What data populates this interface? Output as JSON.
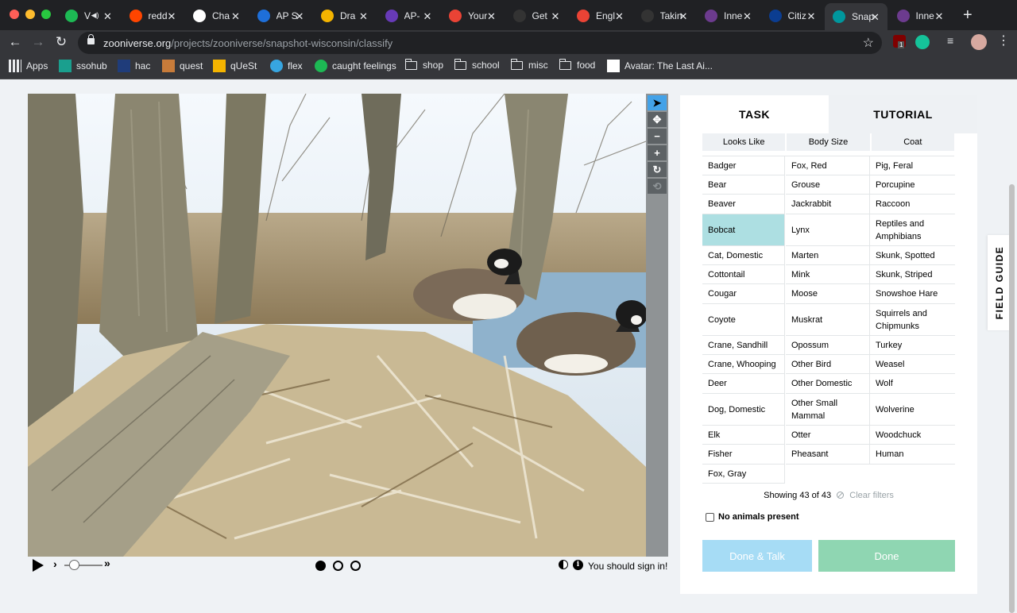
{
  "browser": {
    "tabs": [
      {
        "title": "V",
        "favicon": "spotify-icon",
        "color": "#1db954",
        "audio": true
      },
      {
        "title": "redd",
        "favicon": "reddit-icon",
        "color": "#ff4500"
      },
      {
        "title": "Cha",
        "favicon": "github-icon",
        "color": "#ffffff"
      },
      {
        "title": "AP S",
        "favicon": "classroom-icon",
        "color": "#1e6fd9"
      },
      {
        "title": "Dra",
        "favicon": "slides-icon",
        "color": "#f4b400"
      },
      {
        "title": "AP-",
        "favicon": "forms-icon",
        "color": "#673ab7"
      },
      {
        "title": "Your",
        "favicon": "gmail-icon",
        "color": "#ea4335"
      },
      {
        "title": "Get",
        "favicon": "github-icon",
        "color": "#333333"
      },
      {
        "title": "Engl",
        "favicon": "gmail-icon",
        "color": "#ea4335"
      },
      {
        "title": "Takin",
        "favicon": "github-icon",
        "color": "#333333"
      },
      {
        "title": "Inne",
        "favicon": "zooniverse-icon",
        "color": "#6c3b8e"
      },
      {
        "title": "Citiz",
        "favicon": "nasa-icon",
        "color": "#0b3d91"
      },
      {
        "title": "Snap",
        "favicon": "zooniverse-icon",
        "color": "#00979d",
        "active": true
      },
      {
        "title": "Inne",
        "favicon": "zooniverse-icon",
        "color": "#6c3b8e"
      }
    ],
    "url_domain": "zooniverse.org",
    "url_path": "/projects/zooniverse/snapshot-wisconsin/classify",
    "extension_badge": "1",
    "bookmarks": [
      {
        "label": "Apps",
        "icon": "apps-grid-icon"
      },
      {
        "label": "ssohub",
        "icon": "ssohub-icon"
      },
      {
        "label": "hac",
        "icon": "hac-icon"
      },
      {
        "label": "quest",
        "icon": "quest-icon"
      },
      {
        "label": "qUeSt",
        "icon": "google-drive-icon"
      },
      {
        "label": "flex",
        "icon": "flex-icon"
      },
      {
        "label": "caught feelings",
        "icon": "spotify-icon"
      },
      {
        "label": "shop",
        "icon": "folder-icon"
      },
      {
        "label": "school",
        "icon": "folder-icon"
      },
      {
        "label": "misc",
        "icon": "folder-icon"
      },
      {
        "label": "food",
        "icon": "folder-icon"
      },
      {
        "label": "Avatar: The Last Ai...",
        "icon": "dailymotion-icon"
      }
    ]
  },
  "viewer": {
    "tools": [
      {
        "icon": "pointer-icon",
        "glyph": "➤",
        "selected": true
      },
      {
        "icon": "move-icon",
        "glyph": "✥"
      },
      {
        "icon": "zoom-out-icon",
        "glyph": "−"
      },
      {
        "icon": "zoom-in-icon",
        "glyph": "+"
      },
      {
        "icon": "rotate-icon",
        "glyph": "↻"
      },
      {
        "icon": "reset-icon",
        "glyph": "⟲",
        "dim": true
      }
    ],
    "playback_speed_position": 0.25,
    "frames": 3,
    "current_frame": 1,
    "sign_in_text": "You should sign in!"
  },
  "task_panel": {
    "tabs": {
      "task": "TASK",
      "tutorial": "TUTORIAL"
    },
    "filters": [
      "Looks Like",
      "Body Size",
      "Coat"
    ],
    "choices": [
      [
        "Badger",
        "Fox, Red",
        "Pig, Feral"
      ],
      [
        "Bear",
        "Grouse",
        "Porcupine"
      ],
      [
        "Beaver",
        "Jackrabbit",
        "Raccoon"
      ],
      [
        "Bobcat",
        "Lynx",
        "Reptiles and Amphibians"
      ],
      [
        "Cat, Domestic",
        "Marten",
        "Skunk, Spotted"
      ],
      [
        "Cottontail",
        "Mink",
        "Skunk, Striped"
      ],
      [
        "Cougar",
        "Moose",
        "Snowshoe Hare"
      ],
      [
        "Coyote",
        "Muskrat",
        "Squirrels and Chipmunks"
      ],
      [
        "Crane, Sandhill",
        "Opossum",
        "Turkey"
      ],
      [
        "Crane, Whooping",
        "Other Bird",
        "Weasel"
      ],
      [
        "Deer",
        "Other Domestic",
        "Wolf"
      ],
      [
        "Dog, Domestic",
        "Other Small Mammal",
        "Wolverine"
      ],
      [
        "Elk",
        "Otter",
        "Woodchuck"
      ],
      [
        "Fisher",
        "Pheasant",
        "Human"
      ],
      [
        "Fox, Gray"
      ]
    ],
    "highlighted_choice": "Bobcat",
    "showing_text": "Showing 43 of 43",
    "clear_filters": "Clear filters",
    "no_animals_label": "No animals present",
    "done_talk_label": "Done & Talk",
    "done_label": "Done"
  },
  "field_guide_label": "FIELD GUIDE"
}
